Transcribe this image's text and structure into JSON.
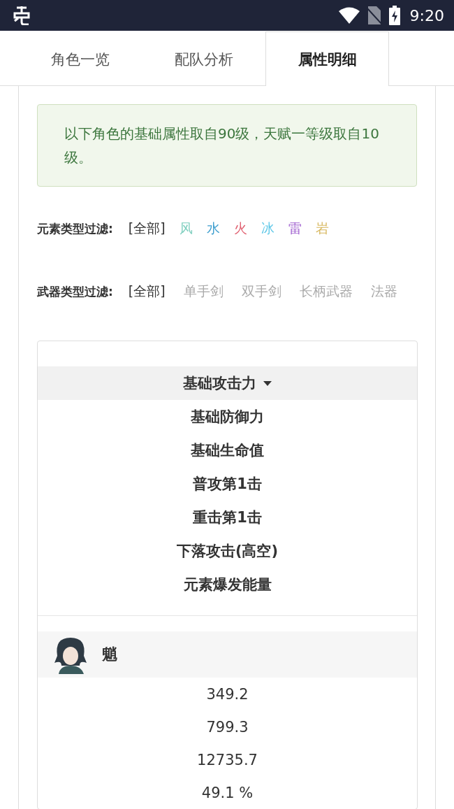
{
  "status_bar": {
    "time": "9:20"
  },
  "tabs": [
    {
      "label": "角色一览",
      "selected": false
    },
    {
      "label": "配队分析",
      "selected": false
    },
    {
      "label": "属性明细",
      "selected": true
    }
  ],
  "notice": "以下角色的基础属性取自90级，天赋一等级取自10级。",
  "element_filter": {
    "label": "元素类型过滤:",
    "options": [
      {
        "label": "[全部]",
        "selected": true
      },
      {
        "label": "风",
        "selected": false,
        "color": "#7fcfbf"
      },
      {
        "label": "水",
        "selected": false,
        "color": "#3f9fcf"
      },
      {
        "label": "火",
        "selected": false,
        "color": "#e06070"
      },
      {
        "label": "冰",
        "selected": false,
        "color": "#5fc8e8"
      },
      {
        "label": "雷",
        "selected": false,
        "color": "#a060d0"
      },
      {
        "label": "岩",
        "selected": false,
        "color": "#d8b860"
      }
    ]
  },
  "weapon_filter": {
    "label": "武器类型过滤:",
    "options": [
      {
        "label": "[全部]",
        "selected": true
      },
      {
        "label": "单手剑",
        "selected": false
      },
      {
        "label": "双手剑",
        "selected": false
      },
      {
        "label": "长柄武器",
        "selected": false
      },
      {
        "label": "法器",
        "selected": false
      }
    ]
  },
  "sort_options": [
    {
      "label": "基础攻击力",
      "selected": true
    },
    {
      "label": "基础防御力",
      "selected": false
    },
    {
      "label": "基础生命值",
      "selected": false
    },
    {
      "label": "普攻第1击",
      "selected": false
    },
    {
      "label": "重击第1击",
      "selected": false
    },
    {
      "label": "下落攻击(高空)",
      "selected": false
    },
    {
      "label": "元素爆发能量",
      "selected": false
    }
  ],
  "characters": [
    {
      "name": "魈",
      "values": [
        "349.2",
        "799.3",
        "12735.7",
        "49.1 %"
      ]
    }
  ]
}
